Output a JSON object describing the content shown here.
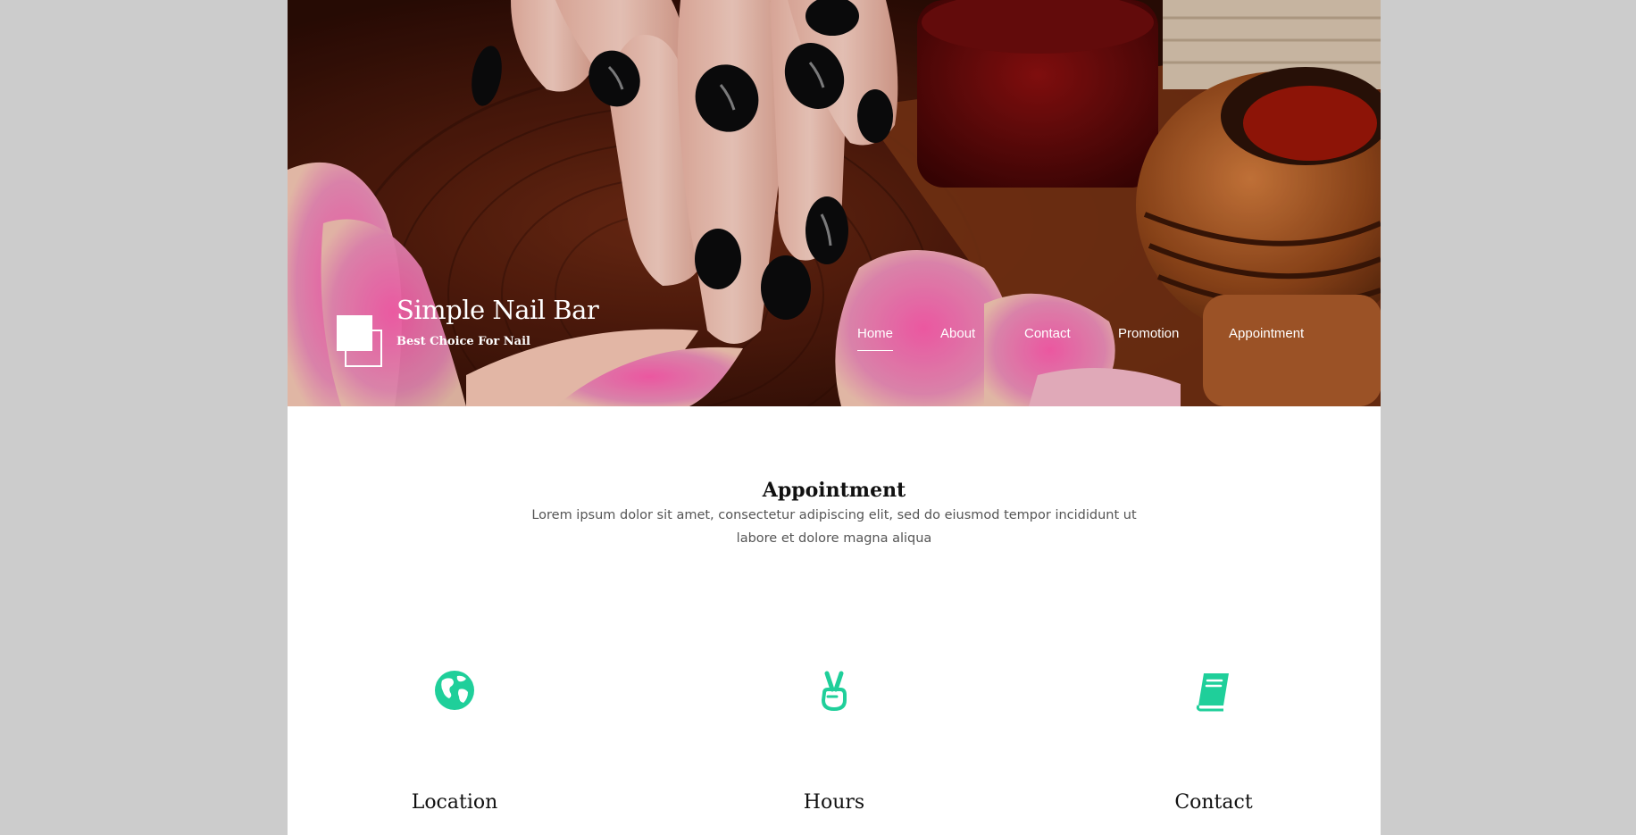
{
  "brand": {
    "title": "Simple Nail Bar",
    "tagline": "Best Choice For Nail"
  },
  "nav": {
    "items": [
      {
        "label": "Home",
        "active": true
      },
      {
        "label": "About",
        "active": false
      },
      {
        "label": "Contact",
        "active": false
      },
      {
        "label": "Promotion",
        "active": false
      },
      {
        "label": "Appointment",
        "active": false
      }
    ]
  },
  "section": {
    "title": "Appointment",
    "description": "Lorem ipsum dolor sit amet, consectetur adipiscing elit, sed do eiusmod tempor incididunt ut labore et dolore magna aliqua"
  },
  "features": [
    {
      "icon": "globe-icon",
      "label": "Location"
    },
    {
      "icon": "peace-hand-icon",
      "label": "Hours"
    },
    {
      "icon": "book-icon",
      "label": "Contact"
    }
  ],
  "colors": {
    "accent": "#1fcf9a",
    "page_background": "#cccccc",
    "content_background": "#ffffff"
  }
}
